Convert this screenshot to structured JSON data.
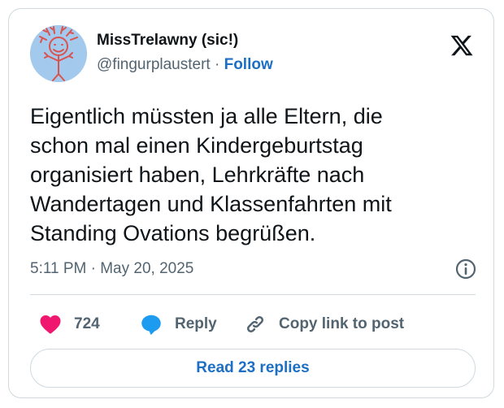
{
  "user": {
    "display_name": "MissTrelawny (sic!)",
    "handle": "@fingurplaustert",
    "separator": "·",
    "follow_label": "Follow",
    "avatar_icon": "drawn-figure-avatar"
  },
  "brand": {
    "logo_icon": "x-logo-icon"
  },
  "tweet": {
    "text_lines": [
      "Eigentlich müssten ja alle Eltern, die",
      "schon mal einen Kindergeburtstag",
      "organisiert haben, Lehrkräfte nach",
      "Wandertagen und Klassenfahrten mit",
      "Standing Ovations begrüßen."
    ],
    "timestamp": "5:11 PM · May 20, 2025"
  },
  "actions": {
    "like_count": "724",
    "reply_label": "Reply",
    "copy_label": "Copy link to post"
  },
  "footer": {
    "read_replies_label": "Read 23 replies"
  },
  "colors": {
    "accent": "#1d6fc4",
    "like": "#f0186e",
    "reply_bubble": "#1d9bf0",
    "secondary_text": "#536471",
    "border": "#cfd9de"
  }
}
